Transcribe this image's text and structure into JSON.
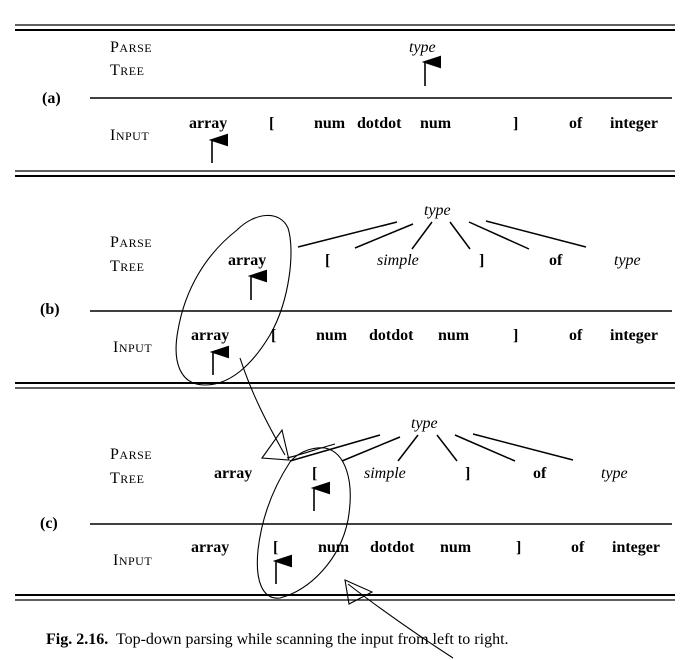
{
  "figure": {
    "caption_number": "Fig. 2.16.",
    "caption_text": "Top-down parsing while scanning the input from left to right."
  },
  "row_labels": {
    "parse": "Parse",
    "tree": "Tree",
    "input": "Input"
  },
  "panels": [
    {
      "id": "a",
      "label": "(a)",
      "parse_tree": {
        "root": "type",
        "children": []
      },
      "input_tokens": [
        "array",
        "[",
        "num",
        "dotdot",
        "num",
        "]",
        "of",
        "integer"
      ],
      "input_pointer_index": 0,
      "tree_pointer": "root"
    },
    {
      "id": "b",
      "label": "(b)",
      "parse_tree": {
        "root": "type",
        "children": [
          "array",
          "[",
          "simple",
          "]",
          "of",
          "type"
        ]
      },
      "child_styles": [
        "terminal",
        "terminal",
        "nonterminal",
        "terminal",
        "terminal",
        "nonterminal"
      ],
      "input_tokens": [
        "array",
        "[",
        "num",
        "dotdot",
        "num",
        "]",
        "of",
        "integer"
      ],
      "input_pointer_index": 0,
      "tree_pointer_child_index": 0
    },
    {
      "id": "c",
      "label": "(c)",
      "parse_tree": {
        "root": "type",
        "children": [
          "array",
          "[",
          "simple",
          "]",
          "of",
          "type"
        ]
      },
      "child_styles": [
        "terminal",
        "terminal",
        "nonterminal",
        "terminal",
        "terminal",
        "nonterminal"
      ],
      "input_tokens": [
        "array",
        "[",
        "num",
        "dotdot",
        "num",
        "]",
        "of",
        "integer"
      ],
      "input_pointer_index": 1,
      "tree_pointer_child_index": 1
    }
  ],
  "annotations": {
    "description": "hand-drawn ellipses around matched token pairs with connecting arrows"
  }
}
